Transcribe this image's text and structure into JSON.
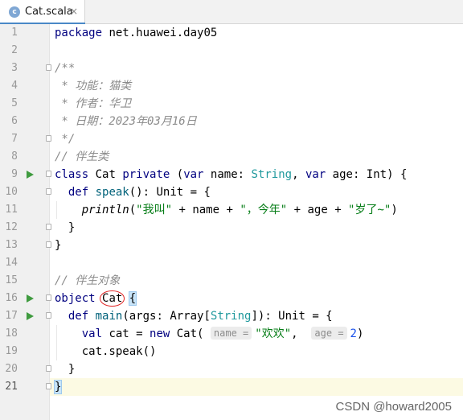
{
  "tab": {
    "icon": "c",
    "label": "Cat.scala",
    "close": "×"
  },
  "lines": [
    {
      "n": "1",
      "t": "package net.huawei.day05"
    },
    {
      "n": "2",
      "t": ""
    },
    {
      "n": "3",
      "t": "/**"
    },
    {
      "n": "4",
      "t": " * 功能：猫类"
    },
    {
      "n": "5",
      "t": " * 作者：华卫"
    },
    {
      "n": "6",
      "t": " * 日期：2023年03月16日"
    },
    {
      "n": "7",
      "t": " */"
    },
    {
      "n": "8",
      "t": "// 伴生类"
    },
    {
      "n": "9",
      "t": "class Cat private (var name: String, var age: Int) {"
    },
    {
      "n": "10",
      "t": "  def speak(): Unit = {"
    },
    {
      "n": "11",
      "t": "    println(\"我叫\" + name + \"，今年\" + age + \"岁了~\")"
    },
    {
      "n": "12",
      "t": "  }"
    },
    {
      "n": "13",
      "t": "}"
    },
    {
      "n": "14",
      "t": ""
    },
    {
      "n": "15",
      "t": "// 伴生对象"
    },
    {
      "n": "16",
      "t": "object Cat {"
    },
    {
      "n": "17",
      "t": "  def main(args: Array[String]): Unit = {"
    },
    {
      "n": "18",
      "t": "    val cat = new Cat( name = \"欢欢\",  age = 2)"
    },
    {
      "n": "19",
      "t": "    cat.speak()"
    },
    {
      "n": "20",
      "t": "  }"
    },
    {
      "n": "21",
      "t": "}"
    }
  ],
  "watermark": "CSDN @howard2005",
  "colors": {
    "keyword": "#000080",
    "type": "#20999d",
    "string": "#067d17",
    "comment": "#8c8c8c",
    "run": "#3f9b3f",
    "tab_accent": "#4a88c7",
    "current_line": "#fcfae3"
  }
}
